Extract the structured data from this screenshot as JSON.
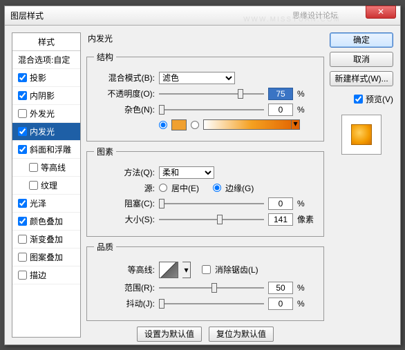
{
  "titlebar": {
    "title": "图层样式",
    "watermark1": "思缘设计论坛",
    "watermark2": "WWW.MISSYUAN.COM"
  },
  "left": {
    "head": "样式",
    "blend_opts": "混合选项:自定",
    "items": [
      {
        "label": "投影",
        "checked": true
      },
      {
        "label": "内阴影",
        "checked": true
      },
      {
        "label": "外发光",
        "checked": false
      },
      {
        "label": "内发光",
        "checked": true,
        "selected": true
      },
      {
        "label": "斜面和浮雕",
        "checked": true
      },
      {
        "label": "等高线",
        "checked": false,
        "indent": true
      },
      {
        "label": "纹理",
        "checked": false,
        "indent": true
      },
      {
        "label": "光泽",
        "checked": true
      },
      {
        "label": "颜色叠加",
        "checked": true
      },
      {
        "label": "渐变叠加",
        "checked": false
      },
      {
        "label": "图案叠加",
        "checked": false
      },
      {
        "label": "描边",
        "checked": false
      }
    ]
  },
  "center": {
    "title": "内发光",
    "group1": {
      "legend": "结构",
      "blend_label": "混合模式(B):",
      "blend_value": "滤色",
      "opacity_label": "不透明度(O):",
      "opacity_value": "75",
      "noise_label": "杂色(N):",
      "noise_value": "0",
      "pct": "%"
    },
    "group2": {
      "legend": "图素",
      "method_label": "方法(Q):",
      "method_value": "柔和",
      "source_label": "源:",
      "source_center": "居中(E)",
      "source_edge": "边缘(G)",
      "choke_label": "阻塞(C):",
      "choke_value": "0",
      "size_label": "大小(S):",
      "size_value": "141",
      "px": "像素",
      "pct": "%"
    },
    "group3": {
      "legend": "品质",
      "contour_label": "等高线:",
      "antialias": "消除锯齿(L)",
      "range_label": "范围(R):",
      "range_value": "50",
      "jitter_label": "抖动(J):",
      "jitter_value": "0",
      "pct": "%"
    },
    "footer": {
      "default": "设置为默认值",
      "reset": "复位为默认值"
    }
  },
  "right": {
    "ok": "确定",
    "cancel": "取消",
    "newstyle": "新建样式(W)...",
    "preview": "预览(V)"
  }
}
